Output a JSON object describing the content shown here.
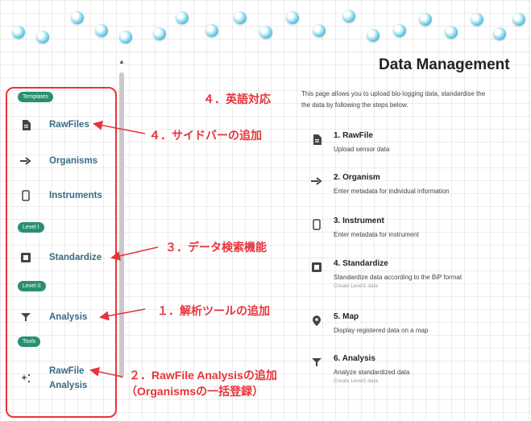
{
  "page": {
    "title": "Data Management",
    "description_line1": "This page allows you to upload bio-logging data, standardise the",
    "description_line2": "the data by following the steps below."
  },
  "sidebar": {
    "sections": [
      "Templates",
      "Level I",
      "Level II",
      "Tools"
    ],
    "items": [
      {
        "label": "RawFiles",
        "icon": "file-icon"
      },
      {
        "label": "Organisms",
        "icon": "arrow-right-icon"
      },
      {
        "label": "Instruments",
        "icon": "device-icon"
      },
      {
        "label": "Standardize",
        "icon": "square-icon"
      },
      {
        "label": "Analysis",
        "icon": "filter-icon"
      },
      {
        "label": "RawFile",
        "label2": "Analysis",
        "icon": "sparkle-icon"
      }
    ]
  },
  "steps": [
    {
      "title": "1. RawFile",
      "desc": "Upload sensor data",
      "sub": ""
    },
    {
      "title": "2. Organism",
      "desc": "Enter metadata for individual information",
      "sub": ""
    },
    {
      "title": "3. Instrument",
      "desc": "Enter metadata for instrument",
      "sub": ""
    },
    {
      "title": "4. Standardize",
      "desc": "Standardize data according to the BiP format",
      "sub": "Create Level1 data"
    },
    {
      "title": "5. Map",
      "desc": "Display registered data on a map",
      "sub": ""
    },
    {
      "title": "6. Analysis",
      "desc": "Analyze standardized data",
      "sub": "Create Level2 data"
    }
  ],
  "annotations": {
    "english": "４．英語対応",
    "sidebar": "４．サイドバーの追加",
    "search": "３．データ検索機能",
    "analysis_tool": "１．解析ツールの追加",
    "rawfile_analysis_1": "２．RawFile Analysisの追加",
    "rawfile_analysis_2": "（Organismsの一括登録）"
  },
  "colors": {
    "annotation": "#e8333a",
    "pill": "#2a8f72",
    "link": "#3b6b86"
  }
}
